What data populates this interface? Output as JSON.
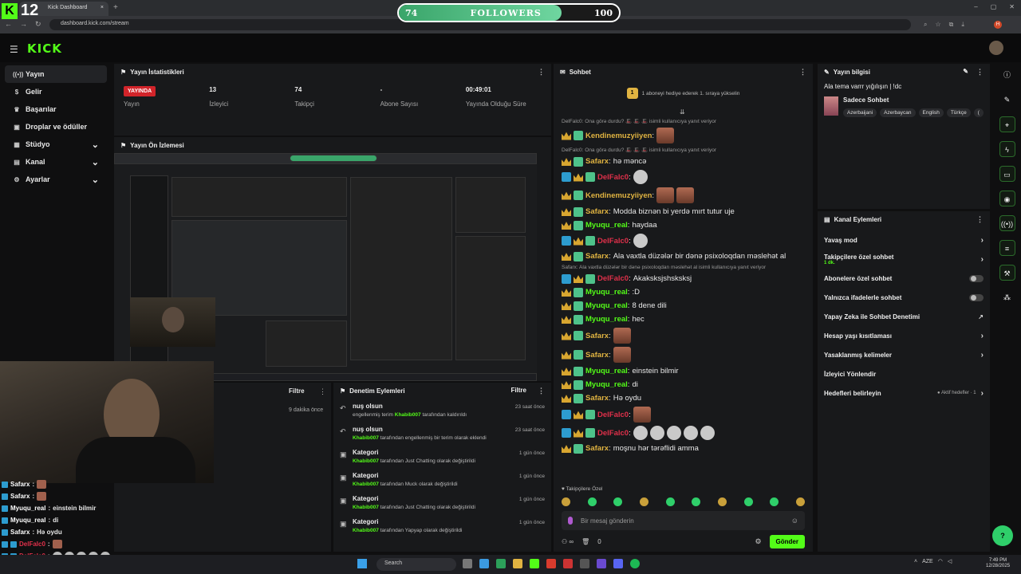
{
  "browser": {
    "tab_title": "Kick Dashboard",
    "tab_close": "×",
    "new_tab": "+",
    "url": "dashboard.kick.com/stream",
    "profile_initial": "H",
    "window_controls": [
      "–",
      "▢",
      "✕"
    ]
  },
  "overlay": {
    "logo_letter": "K",
    "logo_number": "12",
    "followers_label": "FOLLOWERS",
    "followers_current": "74",
    "followers_goal": "100",
    "followers_progress": 0.74
  },
  "app": {
    "logo": "KICK"
  },
  "sidebar": {
    "items": [
      {
        "label": "Yayın",
        "icon": "broadcast-icon",
        "active": true
      },
      {
        "label": "Gelir",
        "icon": "money-icon"
      },
      {
        "label": "Başarılar",
        "icon": "trophy-icon"
      },
      {
        "label": "Droplar ve ödüller",
        "icon": "gift-icon"
      },
      {
        "label": "Stüdyo",
        "icon": "grid-icon",
        "chevron": true
      },
      {
        "label": "Kanal",
        "icon": "channel-icon",
        "chevron": true
      },
      {
        "label": "Ayarlar",
        "icon": "gear-icon",
        "chevron": true
      }
    ]
  },
  "stats": {
    "title": "Yayın İstatistikleri",
    "live_badge": "YAYINDA",
    "items": [
      {
        "value": "",
        "label": "Yayın"
      },
      {
        "value": "13",
        "label": "İzleyici"
      },
      {
        "value": "74",
        "label": "Takipçi"
      },
      {
        "value": "-",
        "label": "Abone Sayısı"
      },
      {
        "value": "00:49:01",
        "label": "Yayında Olduğu Süre"
      }
    ]
  },
  "preview": {
    "title": "Yayın Ön İzlemesi"
  },
  "events": {
    "filter": "Filtre",
    "time": "9 dakika önce"
  },
  "overlay_chat": [
    {
      "user": "Safarx",
      "text": "",
      "color": "#ffffff",
      "badge": false,
      "emotes": 1
    },
    {
      "user": "Safarx",
      "text": "",
      "color": "#ffffff",
      "badge": false,
      "emotes": 1
    },
    {
      "user": "Myuqu_real",
      "text": "einstein bilmir",
      "color": "#ffffff",
      "badge": false,
      "emotes": 0
    },
    {
      "user": "Myuqu_real",
      "text": "di",
      "color": "#ffffff",
      "badge": false,
      "emotes": 0
    },
    {
      "user": "Safarx",
      "text": "Hə oydu",
      "color": "#ffffff",
      "badge": false,
      "emotes": 0
    },
    {
      "user": "DelFalc0",
      "text": "",
      "color": "#e0304a",
      "badge": true,
      "emotes": 1
    },
    {
      "user": "DelFalc0",
      "text": "",
      "color": "#e0304a",
      "badge": true,
      "emotes": 5
    },
    {
      "user": "Safarx",
      "text": "moşnu hər tərəflidi amma",
      "color": "#ffffff",
      "badge": false,
      "emotes": 0
    }
  ],
  "moderation": {
    "title": "Denetim Eylemleri",
    "filter": "Filtre",
    "items": [
      {
        "title": "nuş olsun",
        "pre": "engellenmiş terim",
        "user": "Khabib007",
        "post": "tarafından kaldırıldı",
        "time": "23 saat önce",
        "icon": "undo-icon"
      },
      {
        "title": "nuş olsun",
        "pre": "",
        "user": "Khabib007",
        "post": "tarafından engellenmiş bir terim olarak eklendi",
        "time": "23 saat önce",
        "icon": "undo-icon"
      },
      {
        "title": "Kategori",
        "pre": "",
        "user": "Khabib007",
        "post": "tarafından Just Chatting olarak değiştirildi",
        "time": "1 gün önce",
        "icon": "category-icon"
      },
      {
        "title": "Kategori",
        "pre": "",
        "user": "Khabib007",
        "post": "tarafından Muck olarak değiştirildi",
        "time": "1 gün önce",
        "icon": "category-icon"
      },
      {
        "title": "Kategori",
        "pre": "",
        "user": "Khabib007",
        "post": "tarafından Just Chatting olarak değiştirildi",
        "time": "1 gün önce",
        "icon": "category-icon"
      },
      {
        "title": "Kategori",
        "pre": "",
        "user": "Khabib007",
        "post": "tarafından Yapyap olarak değiştirildi",
        "time": "1 gün önce",
        "icon": "category-icon"
      }
    ]
  },
  "chat": {
    "title": "Sohbet",
    "pinned_badge": "1",
    "pinned_text": "1 aboneyi hediye ederek 1. sıraya yükselin",
    "messages": [
      {
        "reply": "DelFalc0: Ona görə durdu? 🎩 🎩 🎩 isimli kullanıcıya yanıt veriyor",
        "badges": [
          "crown",
          "green"
        ],
        "user": "Kendinemuzyiiyen",
        "color": "#e0b341",
        "text": "",
        "emotes": 1,
        "emote_type": "big"
      },
      {
        "reply": "DelFalc0: Ona görə durdu? 🎩 🎩 🎩 isimli kullanıcıya yanıt veriyor",
        "badges": [
          "crown",
          "green"
        ],
        "user": "Safarx",
        "color": "#e0b341",
        "text": "hə məncə",
        "emotes": 0,
        "emote_type": ""
      },
      {
        "reply": "",
        "badges": [
          "sword",
          "crown",
          "green"
        ],
        "user": "DelFalc0",
        "color": "#e0304a",
        "text": "",
        "emotes": 1,
        "emote_type": "round"
      },
      {
        "reply": "",
        "badges": [
          "crown",
          "green"
        ],
        "user": "Kendinemuzyiiyen",
        "color": "#e0b341",
        "text": "",
        "emotes": 2,
        "emote_type": "big"
      },
      {
        "reply": "",
        "badges": [
          "crown",
          "green"
        ],
        "user": "Safarx",
        "color": "#e0b341",
        "text": "Modda biznən bi yerdə mırt tutur uje",
        "emotes": 0,
        "emote_type": ""
      },
      {
        "reply": "",
        "badges": [
          "crown",
          "green"
        ],
        "user": "Myuqu_real",
        "color": "#53fc18",
        "text": "haydaa",
        "emotes": 0,
        "emote_type": ""
      },
      {
        "reply": "",
        "badges": [
          "sword",
          "crown",
          "green"
        ],
        "user": "DelFalc0",
        "color": "#e0304a",
        "text": "",
        "emotes": 1,
        "emote_type": "round"
      },
      {
        "reply": "",
        "badges": [
          "crown",
          "green"
        ],
        "user": "Safarx",
        "color": "#e0b341",
        "text": "Ala vaxtla düzələr bir dənə psixoloqdan məslehət al",
        "emotes": 0,
        "emote_type": ""
      },
      {
        "reply": "Safarx: Ala vaxtla düzələr bir dənə psixoloqdan məslehət al isimli kullanıcıya yanıt veriyor",
        "badges": [
          "sword",
          "crown",
          "green"
        ],
        "user": "DelFalc0",
        "color": "#e0304a",
        "text": "Akaksksjshsksksj",
        "emotes": 0,
        "emote_type": ""
      },
      {
        "reply": "",
        "badges": [
          "crown",
          "green"
        ],
        "user": "Myuqu_real",
        "color": "#53fc18",
        "text": ":D",
        "emotes": 0,
        "emote_type": ""
      },
      {
        "reply": "",
        "badges": [
          "crown",
          "green"
        ],
        "user": "Myuqu_real",
        "color": "#53fc18",
        "text": "8 dene dili",
        "emotes": 0,
        "emote_type": ""
      },
      {
        "reply": "",
        "badges": [
          "crown",
          "green"
        ],
        "user": "Myuqu_real",
        "color": "#53fc18",
        "text": "hec",
        "emotes": 0,
        "emote_type": ""
      },
      {
        "reply": "",
        "badges": [
          "crown",
          "green"
        ],
        "user": "Safarx",
        "color": "#e0b341",
        "text": "",
        "emotes": 1,
        "emote_type": "big"
      },
      {
        "reply": "",
        "badges": [
          "crown",
          "green"
        ],
        "user": "Safarx",
        "color": "#e0b341",
        "text": "",
        "emotes": 1,
        "emote_type": "big"
      },
      {
        "reply": "",
        "badges": [
          "crown",
          "green"
        ],
        "user": "Myuqu_real",
        "color": "#53fc18",
        "text": "einstein bilmir",
        "emotes": 0,
        "emote_type": ""
      },
      {
        "reply": "",
        "badges": [
          "crown",
          "green"
        ],
        "user": "Myuqu_real",
        "color": "#53fc18",
        "text": "di",
        "emotes": 0,
        "emote_type": ""
      },
      {
        "reply": "",
        "badges": [
          "crown",
          "green"
        ],
        "user": "Safarx",
        "color": "#e0b341",
        "text": "Hə oydu",
        "emotes": 0,
        "emote_type": ""
      },
      {
        "reply": "",
        "badges": [
          "sword",
          "crown",
          "green"
        ],
        "user": "DelFalc0",
        "color": "#e0304a",
        "text": "",
        "emotes": 1,
        "emote_type": "big"
      },
      {
        "reply": "",
        "badges": [
          "sword",
          "crown",
          "green"
        ],
        "user": "DelFalc0",
        "color": "#e0304a",
        "text": "",
        "emotes": 5,
        "emote_type": "round"
      },
      {
        "reply": "",
        "badges": [
          "crown",
          "green"
        ],
        "user": "Safarx",
        "color": "#e0b341",
        "text": "moşnu hər tərəflidi amma",
        "emotes": 0,
        "emote_type": ""
      }
    ],
    "followers_only_label": "Takipçilere Özel",
    "input_placeholder": "Bir mesaj gönderin",
    "bottom_count": "0",
    "send_label": "Gönder"
  },
  "stream_info": {
    "title": "Yayın bilgisi",
    "stream_title": "Ala tema varrr yığılışın | !dc",
    "category": "Sadece Sohbet",
    "tags": [
      "Azerbaijani",
      "Azerbaycan",
      "English",
      "Türkçe",
      "("
    ]
  },
  "channel_actions": {
    "title": "Kanal Eylemleri",
    "items": [
      {
        "label": "Yavaş mod",
        "sub": "",
        "control": "chevron"
      },
      {
        "label": "Takipçilere özel sohbet",
        "sub": "1 dk.",
        "control": "chevron"
      },
      {
        "label": "Abonelere özel sohbet",
        "sub": "",
        "control": "toggle"
      },
      {
        "label": "Yalnızca ifadelerle sohbet",
        "sub": "",
        "control": "toggle"
      },
      {
        "label": "Yapay Zeka ile Sohbet Denetimi",
        "sub": "",
        "control": "external"
      },
      {
        "label": "Hesap yaşı kısıtlaması",
        "sub": "",
        "control": "chevron"
      },
      {
        "label": "Yasaklanmış kelimeler",
        "sub": "",
        "control": "chevron"
      },
      {
        "label": "İzleyici Yönlendir",
        "sub": "",
        "control": "none"
      },
      {
        "label": "Hedefleri belirleyin",
        "sub": "",
        "control": "chevron",
        "note": "● Aktif hedefler · 1"
      }
    ]
  },
  "taskbar": {
    "search": "Search",
    "lang": "AZE",
    "time": "7:49 PM",
    "date": "12/28/2025"
  },
  "colors": {
    "accent": "#53fc18",
    "live": "#d2242a",
    "panel": "#18191b"
  }
}
